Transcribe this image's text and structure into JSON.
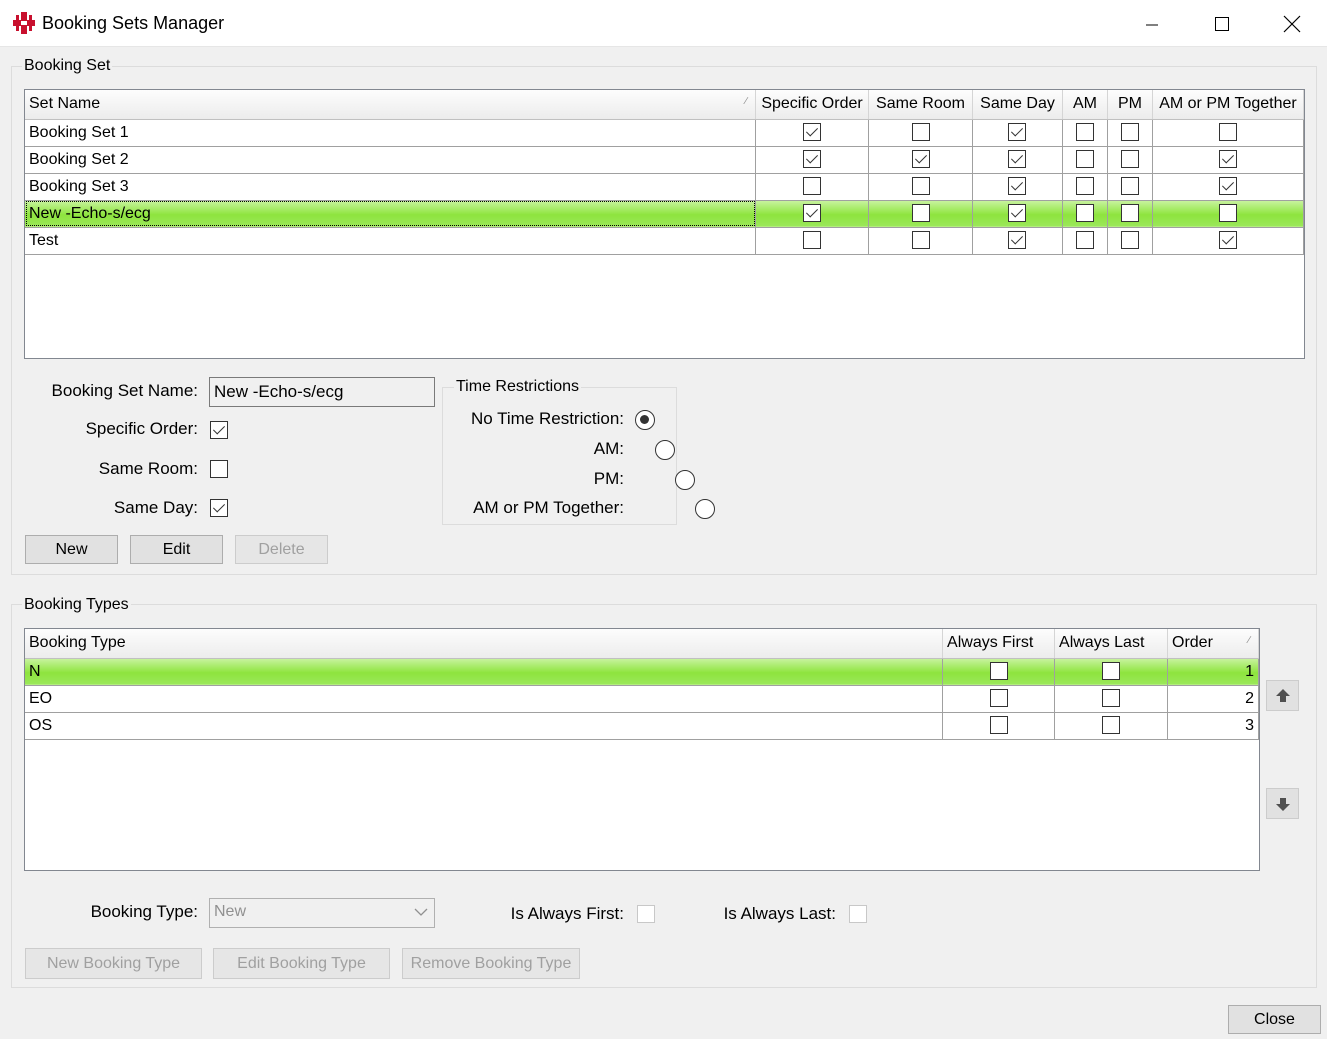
{
  "window": {
    "title": "Booking Sets Manager",
    "accent": "#c8102e"
  },
  "booking_set": {
    "group_title": "Booking Set",
    "columns": [
      "Set Name",
      "Specific Order",
      "Same Room",
      "Same Day",
      "AM",
      "PM",
      "AM or PM Together"
    ],
    "rows": [
      {
        "name": "Booking Set 1",
        "flags": [
          true,
          false,
          true,
          false,
          false,
          false
        ]
      },
      {
        "name": "Booking Set 2",
        "flags": [
          true,
          true,
          true,
          false,
          false,
          true
        ]
      },
      {
        "name": "Booking Set 3",
        "flags": [
          false,
          false,
          true,
          false,
          false,
          true
        ]
      },
      {
        "name": "New -Echo-s/ecg",
        "flags": [
          true,
          false,
          true,
          false,
          false,
          false
        ],
        "selected": true
      },
      {
        "name": "Test",
        "flags": [
          false,
          false,
          true,
          false,
          false,
          true
        ]
      }
    ],
    "selected_color": "#8ee43e",
    "form": {
      "name_label": "Booking Set Name:",
      "name_value": "New -Echo-s/ecg",
      "specific_order_label": "Specific Order:",
      "specific_order": true,
      "same_room_label": "Same Room:",
      "same_room": false,
      "same_day_label": "Same Day:",
      "same_day": true
    },
    "time_restrictions": {
      "title": "Time Restrictions",
      "options": [
        {
          "label": "No Time Restriction:",
          "selected": true
        },
        {
          "label": "AM:",
          "selected": false
        },
        {
          "label": "PM:",
          "selected": false
        },
        {
          "label": "AM or PM Together:",
          "selected": false
        }
      ]
    },
    "buttons": {
      "new": "New",
      "edit": "Edit",
      "delete": "Delete"
    }
  },
  "booking_types": {
    "group_title": "Booking Types",
    "columns": [
      "Booking Type",
      "Always First",
      "Always Last",
      "Order"
    ],
    "rows": [
      {
        "type": "N",
        "always_first": false,
        "always_last": false,
        "order": "1",
        "selected": true
      },
      {
        "type": "EO",
        "always_first": false,
        "always_last": false,
        "order": "2"
      },
      {
        "type": "OS",
        "always_first": false,
        "always_last": false,
        "order": "3"
      }
    ],
    "form": {
      "type_label": "Booking Type:",
      "type_value": "New",
      "is_always_first_label": "Is Always First:",
      "is_always_last_label": "Is Always Last:"
    },
    "buttons": {
      "new": "New Booking Type",
      "edit": "Edit Booking Type",
      "remove": "Remove Booking Type"
    }
  },
  "footer": {
    "close": "Close"
  }
}
